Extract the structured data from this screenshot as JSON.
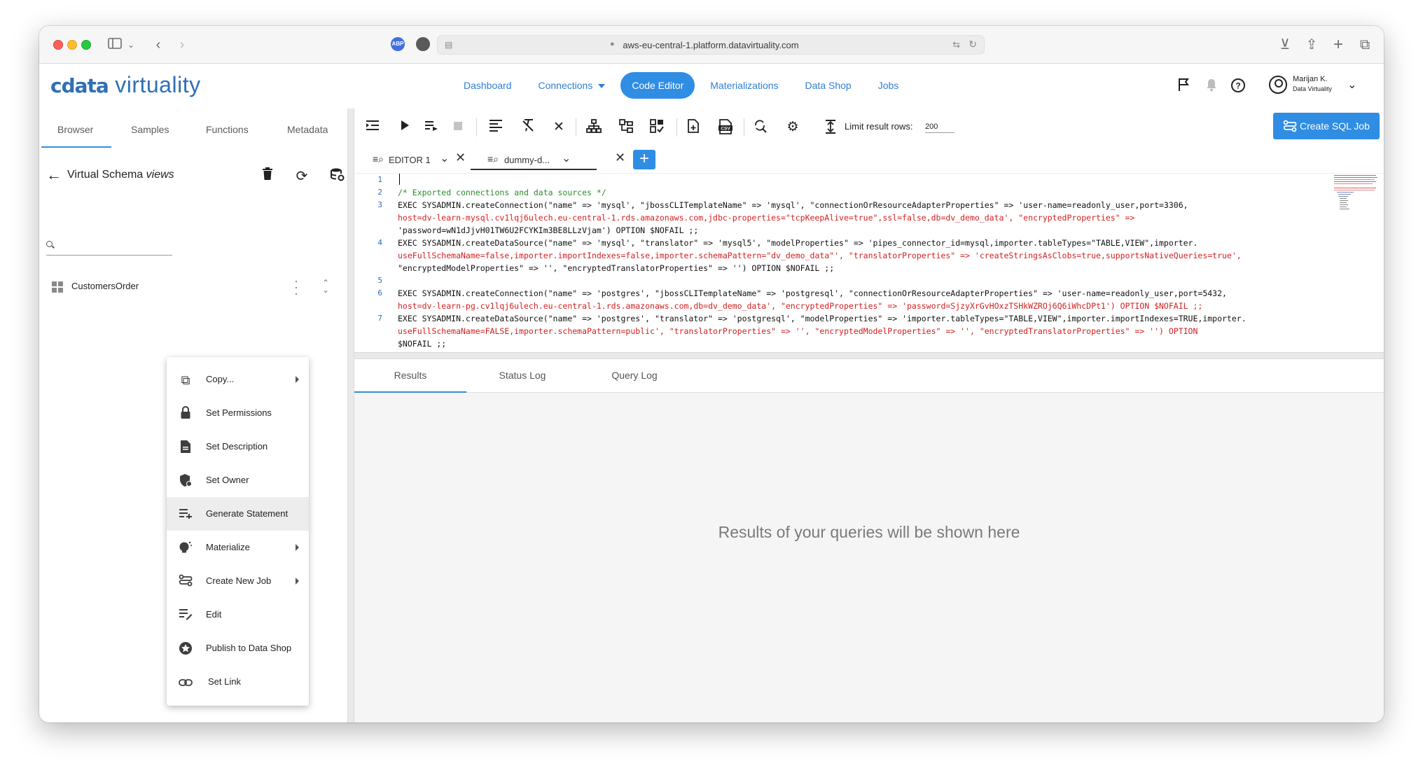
{
  "browser": {
    "url": "aws-eu-central-1.platform.datavirtuality.com",
    "abp_label": "ABP"
  },
  "app": {
    "logo_brand": "cdata",
    "logo_text": " virtuality",
    "nav": [
      {
        "label": "Dashboard"
      },
      {
        "label": "Connections"
      },
      {
        "label": "Code Editor"
      },
      {
        "label": "Materializations"
      },
      {
        "label": "Data Shop"
      },
      {
        "label": "Jobs"
      }
    ],
    "user": {
      "name": "Marijan K.",
      "org": "Data Virtuality"
    }
  },
  "left": {
    "tabs": [
      "Browser",
      "Samples",
      "Functions",
      "Metadata"
    ],
    "schema_title": "Virtual Schema",
    "schema_name": "views",
    "search_value": "",
    "tree_item": "CustomersOrder"
  },
  "context_menu": [
    {
      "label": "Copy...",
      "icon": "copy-icon",
      "submenu": true
    },
    {
      "label": "Set Permissions",
      "icon": "lock-icon"
    },
    {
      "label": "Set Description",
      "icon": "description-icon"
    },
    {
      "label": "Set Owner",
      "icon": "owner-shield-icon"
    },
    {
      "label": "Generate Statement",
      "icon": "generate-statement-icon"
    },
    {
      "label": "Materialize",
      "icon": "materialize-icon",
      "submenu": true
    },
    {
      "label": "Create New Job",
      "icon": "job-icon",
      "submenu": true
    },
    {
      "label": "Edit",
      "icon": "edit-icon"
    },
    {
      "label": "Publish to Data Shop",
      "icon": "publish-icon"
    },
    {
      "label": "Set Link",
      "icon": "link-icon"
    }
  ],
  "editor": {
    "limit_label": "Limit result rows:",
    "limit_value": "200",
    "create_job_label": "Create SQL Job",
    "tabs": [
      {
        "label": "EDITOR 1"
      },
      {
        "label": "dummy-d..."
      }
    ],
    "line_numbers": [
      "1",
      "2",
      "3",
      "4",
      "5",
      "6",
      "7"
    ],
    "code": {
      "l2": "/* Exported connections and data sources */",
      "l3a": "EXEC SYSADMIN.createConnection(\"name\" => 'mysql', \"jbossCLITemplateName\" => 'mysql', \"connectionOrResourceAdapterProperties\" => 'user-name=readonly_user,port=3306,",
      "l3b": "host=dv-learn-mysql.cv1lqj6ulech.eu-central-1.rds.amazonaws.com,jdbc-properties=\"tcpKeepAlive=true\",ssl=false,db=dv_demo_data', \"encryptedProperties\" =>",
      "l3c": "'password=wN1dJjvH01TW6U2FCYKIm3BE8LLzVjam') OPTION $NOFAIL ;;",
      "l4a": "EXEC SYSADMIN.createDataSource(\"name\" => 'mysql', \"translator\" => 'mysql5', \"modelProperties\" => 'pipes_connector_id=mysql,importer.tableTypes=\"TABLE,VIEW\",importer.",
      "l4b": "useFullSchemaName=false,importer.importIndexes=false,importer.schemaPattern=\"dv_demo_data\"', \"translatorProperties\" => 'createStringsAsClobs=true,supportsNativeQueries=true',",
      "l4c": "\"encryptedModelProperties\" => '', \"encryptedTranslatorProperties\" => '') OPTION $NOFAIL ;;",
      "l6a": "EXEC SYSADMIN.createConnection(\"name\" => 'postgres', \"jbossCLITemplateName\" => 'postgresql', \"connectionOrResourceAdapterProperties\" => 'user-name=readonly_user,port=5432,",
      "l6b": "host=dv-learn-pg.cv1lqj6ulech.eu-central-1.rds.amazonaws.com,db=dv_demo_data', \"encryptedProperties\" => 'password=SjzyXrGvHOxzTSHkWZROj6Q6iWhcDPt1') OPTION $NOFAIL ;;",
      "l7a": "EXEC SYSADMIN.createDataSource(\"name\" => 'postgres', \"translator\" => 'postgresql', \"modelProperties\" => 'importer.tableTypes=\"TABLE,VIEW\",importer.importIndexes=TRUE,importer.",
      "l7b": "useFullSchemaName=FALSE,importer.schemaPattern=public', \"translatorProperties\" => '', \"encryptedModelProperties\" => '', \"encryptedTranslatorProperties\" => '') OPTION",
      "l7c": "$NOFAIL ;;"
    }
  },
  "results": {
    "tabs": [
      "Results",
      "Status Log",
      "Query Log"
    ],
    "empty_message": "Results of your queries will be shown here"
  },
  "colors": {
    "accent": "#2f8de4",
    "logo": "#2f6fb5",
    "keyword": "#1d3fb8",
    "string": "#d42020",
    "comment": "#2e8a2e"
  }
}
